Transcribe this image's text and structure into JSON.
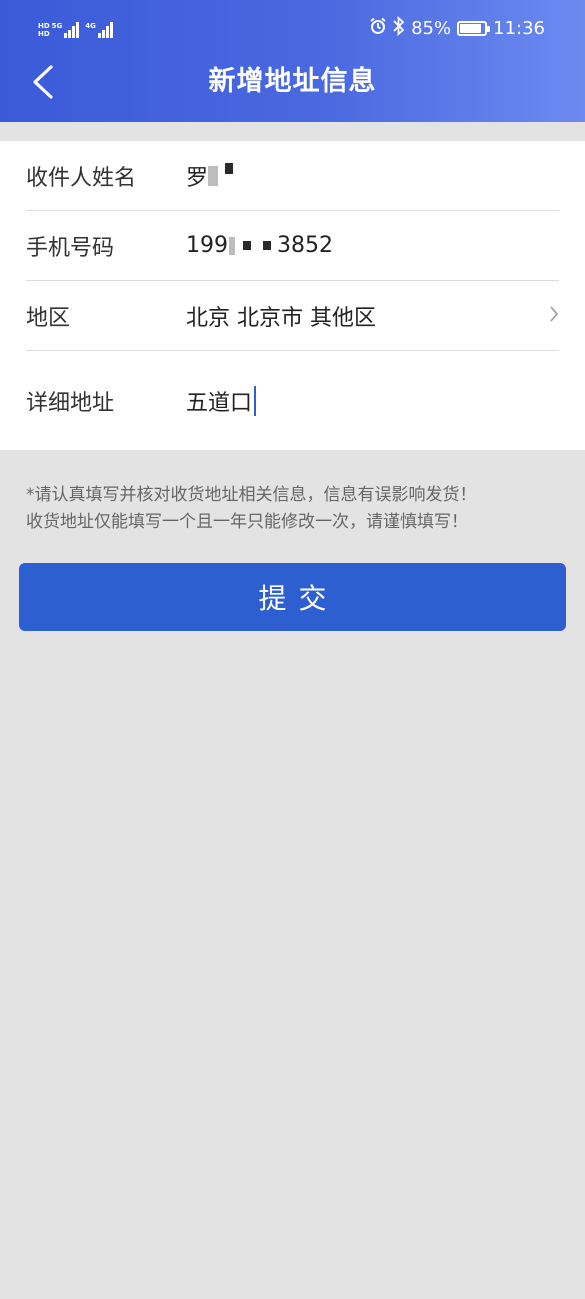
{
  "status_bar": {
    "signal1_tag_top": "HD",
    "signal1_tag_bottom": "HD",
    "signal1_type": "5G",
    "signal2_type": "4G",
    "battery_percent_text": "85%",
    "battery_level": 0.85,
    "time": "11:36",
    "icons": [
      "alarm-icon",
      "bluetooth-icon",
      "battery-icon"
    ]
  },
  "header": {
    "title": "新增地址信息",
    "back_icon": "chevron-left-icon"
  },
  "form": {
    "name": {
      "label": "收件人姓名",
      "value": "罗"
    },
    "phone": {
      "label": "手机号码",
      "value_prefix": "199",
      "value_suffix": "3852"
    },
    "region": {
      "label": "地区",
      "value": "北京 北京市 其他区",
      "icon": "chevron-right-icon"
    },
    "address": {
      "label": "详细地址",
      "value": "五道口"
    }
  },
  "notice": {
    "line1": "*请认真填写并核对收货地址相关信息，信息有误影响发货！",
    "line2": "收货地址仅能填写一个且一年只能修改一次，请谨慎填写！"
  },
  "submit": {
    "label": "提交"
  },
  "colors": {
    "header_start": "#3a5ad8",
    "header_end": "#6c8af0",
    "button": "#2e5fd0",
    "background": "#e3e3e3"
  }
}
